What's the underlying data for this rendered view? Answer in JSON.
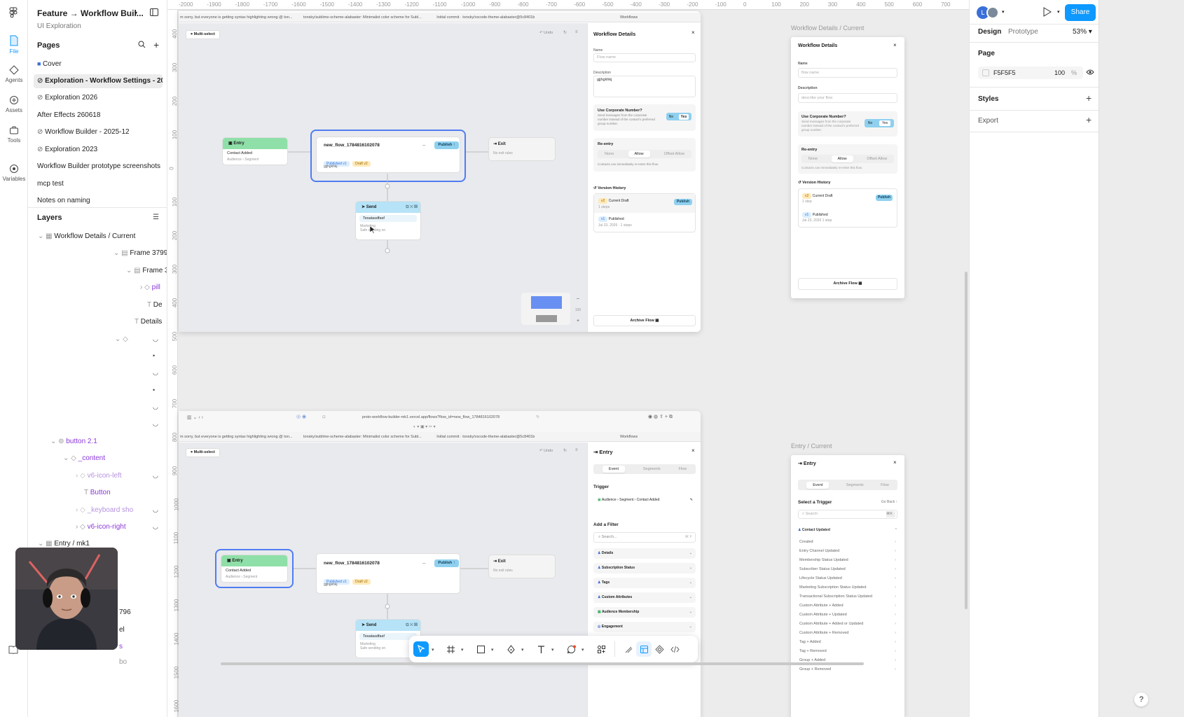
{
  "file": {
    "title": "Feature → Workflow Buil...",
    "subtitle": "UI Exploration"
  },
  "rail": [
    {
      "label": "File",
      "icon": "file-icon"
    },
    {
      "label": "Agents",
      "icon": "agents-icon"
    },
    {
      "label": "Assets",
      "icon": "assets-icon"
    },
    {
      "label": "Tools",
      "icon": "tools-icon"
    },
    {
      "label": "Variables",
      "icon": "variables-icon"
    }
  ],
  "pages": {
    "heading": "Pages",
    "items": [
      {
        "label": "Cover",
        "icon": "cover-icon"
      },
      {
        "label": "Exploration - Workflow Settings - 202...",
        "icon": "exploration-icon"
      },
      {
        "label": "Exploration 2026",
        "icon": "exploration-icon"
      },
      {
        "label": "After Effects 260618",
        "icon": ""
      },
      {
        "label": "Workflow Builder - 2025-12",
        "icon": "exploration-icon"
      },
      {
        "label": "Exploration 2023",
        "icon": "exploration-icon"
      },
      {
        "label": "Workflow Builder prototype screenshots 2...",
        "icon": ""
      },
      {
        "label": "mcp test",
        "icon": ""
      },
      {
        "label": "Notes on naming",
        "icon": ""
      }
    ]
  },
  "layers": {
    "heading": "Layers",
    "items": [
      {
        "label": "Workflow Details / Current"
      },
      {
        "label": "Frame 3799"
      },
      {
        "label": "Frame 3"
      },
      {
        "label": "pill"
      },
      {
        "label": "De"
      },
      {
        "label": "Details"
      },
      {
        "label": "button 2.1"
      },
      {
        "label": "_content"
      },
      {
        "label": "v6-icon-left"
      },
      {
        "label": "Button"
      },
      {
        "label": "_keyboard sho"
      },
      {
        "label": "v6-icon-right"
      },
      {
        "label": "Entry / mk1"
      },
      {
        "label": "796"
      },
      {
        "label": "el"
      },
      {
        "label": "s"
      },
      {
        "label": "bo"
      }
    ]
  },
  "ruler": [
    "-2000",
    "-1900",
    "-1800",
    "-1700",
    "-1600",
    "-1500",
    "-1400",
    "-1300",
    "-1200",
    "-1100",
    "-1000",
    "-900",
    "-800",
    "-700",
    "-600",
    "-500",
    "-400",
    "-300",
    "-200",
    "-100",
    "0",
    "100",
    "200",
    "300",
    "400",
    "500",
    "600",
    "700"
  ],
  "ruler_left": [
    "400",
    "300",
    "200",
    "100",
    "0",
    "100",
    "200",
    "300",
    "400",
    "500",
    "600",
    "700",
    "800",
    "900",
    "1000",
    "1100",
    "1200",
    "1300",
    "1400",
    "1500",
    "1600"
  ],
  "tabs_bar": {
    "tab1": "m sorry, but everyone is getting syntax highlighting wrong @ ton...",
    "tab2": "tonsky/sublime-scheme-alabaster: Minimalist color scheme for Subl...",
    "tab3": "Initial commit · tonsky/vscode-theme-alabaster@5c8401b",
    "tab4": "Workflows"
  },
  "url_bar": {
    "url": "proto-workflow-builder-mk1.vercel.app/flows?flow_id=new_flow_1784816102078"
  },
  "workflow": {
    "multiselect": "Multi-select",
    "undo": "Undo",
    "entry_title": "Entry",
    "entry_body": "Contact Added",
    "entry_sub": "Audience › Segment",
    "flow_name": "new_flow_1784816102078",
    "publish": "Publish",
    "published_pill": "Published v1",
    "draft_pill": "Draft v2",
    "flow_desc": "gjjhgkhkj",
    "exit_title": "Exit",
    "exit_body": "No exit rules",
    "send_title": "Send",
    "send_body": "Tesatasdfasf",
    "send_sub1": "Marketing",
    "send_sub2": "Safe sending on",
    "zoom_pct": "100"
  },
  "details_panel": {
    "title": "Workflow Details",
    "name_label": "Name",
    "name_placeholder": "Flow name",
    "name_placeholder2": "flow name",
    "desc_label": "Description",
    "desc_value": "gjjhgkhkj",
    "desc_placeholder": "describe your flow",
    "corp_title": "Use Corporate Number?",
    "corp_text": "Send messages from the corporate number instead of the contact's preferred group number.",
    "no": "No",
    "yes": "Yes",
    "reentry_title": "Re-entry",
    "reentry_opts": [
      "None",
      "Allow",
      "Offset Allow"
    ],
    "reentry_note": "Contacts can immediately re-enter this flow.",
    "version_title": "Version History",
    "v1_label": "Current Draft",
    "v1_sub": "1 steps",
    "v1_sub2": "1 step",
    "v1_pill": "v2",
    "v2_label": "Published",
    "v2_sub": "Jul 23, 2026 · 1 steps",
    "v2_sub2": "Jul 23, 2026 1 step",
    "v2_pill": "v1",
    "publish": "Publish",
    "archive": "Archive Flow"
  },
  "frame_labels": {
    "details": "Workflow Details / Current",
    "entry": "Entry / Current"
  },
  "entry_panel": {
    "title": "Entry",
    "tabs": [
      "Event",
      "Segments",
      "Flow"
    ],
    "trigger_heading": "Trigger",
    "trigger_value": "Audience › Segment › Contact Added",
    "filter_heading": "Add a Filter",
    "search": "Search...",
    "search_kbd": "⌘ F",
    "groups": [
      "Details",
      "Subscription Status",
      "Tags",
      "Custom Attributes",
      "Audience Membership",
      "Engagement"
    ]
  },
  "entry_current": {
    "title": "Entry",
    "tabs": [
      "Event",
      "Segments",
      "Flow"
    ],
    "select_trigger": "Select a Trigger",
    "go_back": "Go Back",
    "search": "Search",
    "search_kbd": "⌘K",
    "group": "Contact Updated",
    "rows": [
      "Created",
      "Entry Channel Updated",
      "Membership Status Updated",
      "Subscriber Status Updated",
      "Lifecycle Status Updated",
      "Marketing Subscription Status Updated",
      "Transactional Subscription Status Updated",
      "Custom Attribute + Added",
      "Custom Attribute + Updated",
      "Custom Attribute + Added or Updated",
      "Custom Attribute + Removed",
      "Tag + Added",
      "Tag + Removed",
      "Group + Added",
      "Group + Removed"
    ]
  },
  "right_panel": {
    "tabs": [
      "Design",
      "Prototype"
    ],
    "zoom": "53%",
    "share": "Share",
    "avatar": "L",
    "page_heading": "Page",
    "page_color": "F5F5F5",
    "page_opacity": "100",
    "pct": "%",
    "styles": "Styles",
    "export": "Export"
  },
  "help": "?",
  "colors": {
    "accent": "#0d99ff",
    "entry_green": "#8fe0a8",
    "send_blue": "#b6e3f7",
    "select_blue": "#4f7df1",
    "purple": "#8a37d9"
  }
}
